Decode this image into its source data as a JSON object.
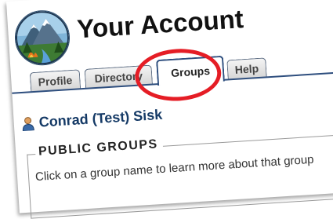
{
  "header": {
    "title": "Your Account"
  },
  "tabs": [
    {
      "label": "Profile"
    },
    {
      "label": "Directory"
    },
    {
      "label": "Groups",
      "active": true
    },
    {
      "label": "Help"
    }
  ],
  "user": {
    "name": "Conrad (Test) Sisk"
  },
  "public_groups": {
    "heading": "PUBLIC GROUPS",
    "description": "Click on a group name to learn more about that group"
  },
  "colors": {
    "accent": "#e51d25",
    "tab_border": "#2e4e7e",
    "link": "#153a66"
  }
}
